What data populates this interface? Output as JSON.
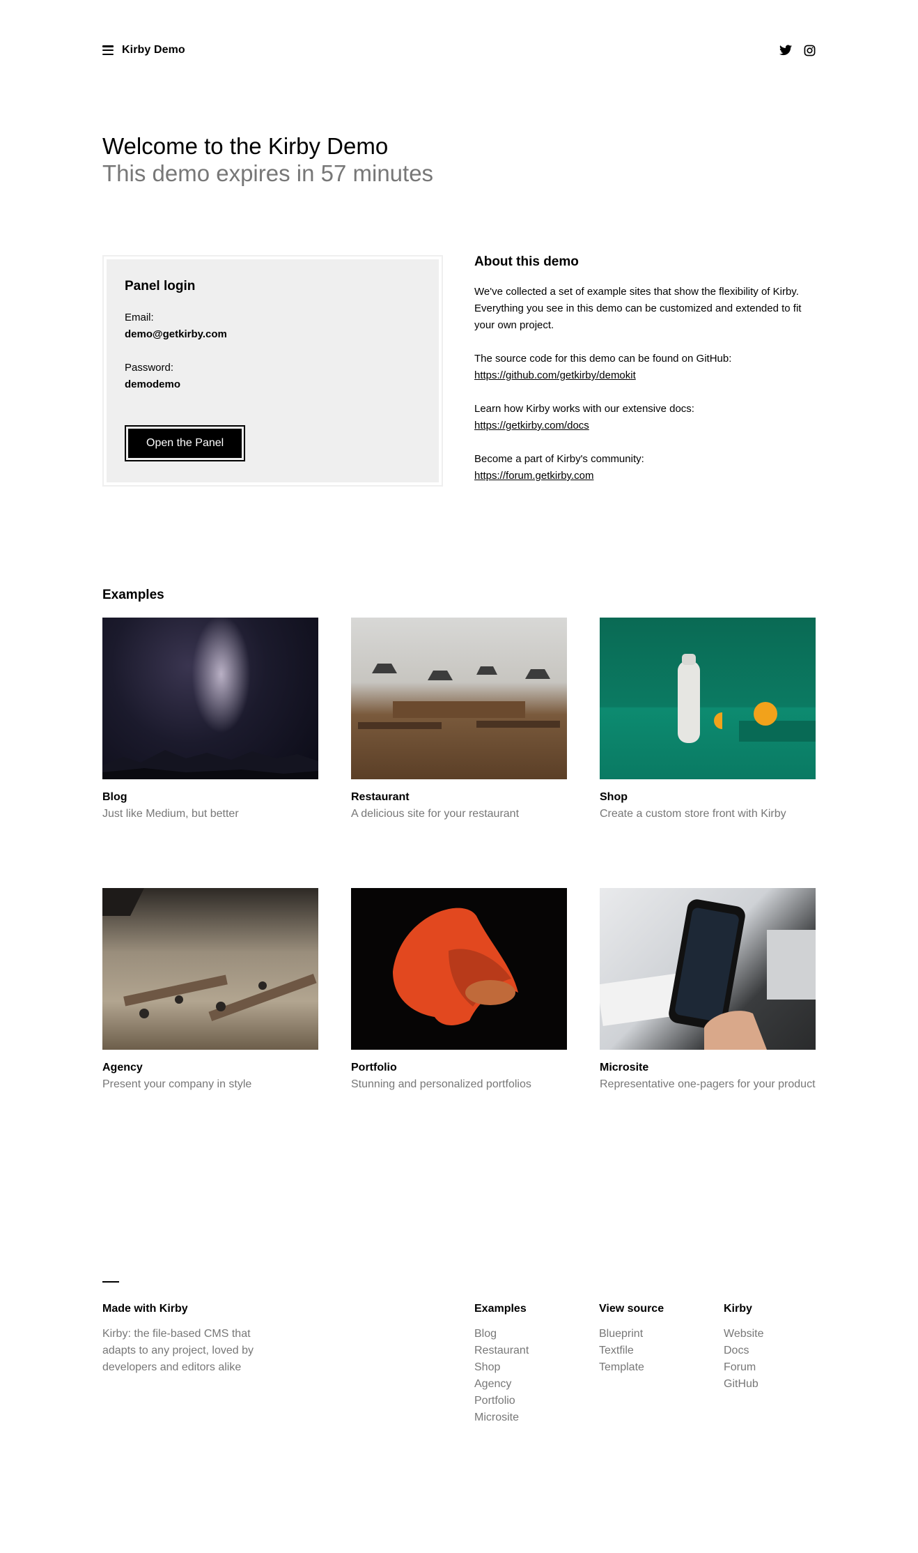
{
  "header": {
    "brand": "Kirby Demo",
    "icons": [
      "menu-icon",
      "twitter-icon",
      "instagram-icon"
    ]
  },
  "hero": {
    "title": "Welcome to the Kirby Demo",
    "subtitle": "This demo expires in 57 minutes"
  },
  "login": {
    "title": "Panel login",
    "email_label": "Email:",
    "email_value": "demo@getkirby.com",
    "password_label": "Password:",
    "password_value": "demodemo",
    "button_label": "Open the Panel"
  },
  "about": {
    "title": "About this demo",
    "intro": "We've collected a set of example sites that show the flexibility of Kirby. Everything you see in this demo can be customized and extended to fit your own project.",
    "github_text": "The source code for this demo can be found on GitHub:",
    "github_link": "https://github.com/getkirby/demokit",
    "docs_text": "Learn how Kirby works with our extensive docs:",
    "docs_link": "https://getkirby.com/docs",
    "forum_text": "Become a part of Kirby's community:",
    "forum_link": "https://forum.getkirby.com"
  },
  "examples": {
    "title": "Examples",
    "items": [
      {
        "title": "Blog",
        "desc": "Just like Medium, but better"
      },
      {
        "title": "Restaurant",
        "desc": "A delicious site for your restaurant"
      },
      {
        "title": "Shop",
        "desc": "Create a custom store front with Kirby"
      },
      {
        "title": "Agency",
        "desc": "Present your company in style"
      },
      {
        "title": "Portfolio",
        "desc": "Stunning and personalized portfolios"
      },
      {
        "title": "Microsite",
        "desc": "Representative one-pagers for your product"
      }
    ]
  },
  "footer": {
    "about_title": "Made with Kirby",
    "about_text": "Kirby: the file-based CMS that adapts to any project, loved by developers and editors alike",
    "examples_title": "Examples",
    "examples_links": [
      "Blog",
      "Restaurant",
      "Shop",
      "Agency",
      "Portfolio",
      "Microsite"
    ],
    "source_title": "View source",
    "source_links": [
      "Blueprint",
      "Textfile",
      "Template"
    ],
    "kirby_title": "Kirby",
    "kirby_links": [
      "Website",
      "Docs",
      "Forum",
      "GitHub"
    ]
  }
}
